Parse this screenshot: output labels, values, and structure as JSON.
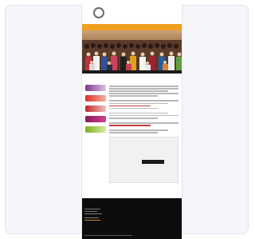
{
  "site": {
    "logo_text": "",
    "nav_label": "",
    "headline": "",
    "section_label": "",
    "form_title": "",
    "footer_title": "",
    "footer_bottom": ""
  },
  "sponsors": [
    {
      "color": "#7a3a8c"
    },
    {
      "color": "#d9302a"
    },
    {
      "color": "#c02828"
    },
    {
      "color": "#8a1a5a"
    },
    {
      "color": "#7ab020"
    }
  ],
  "colors": {
    "accent": "#f0a020",
    "footer": "#0d0d0d",
    "card_bg": "#f4f6fa"
  }
}
